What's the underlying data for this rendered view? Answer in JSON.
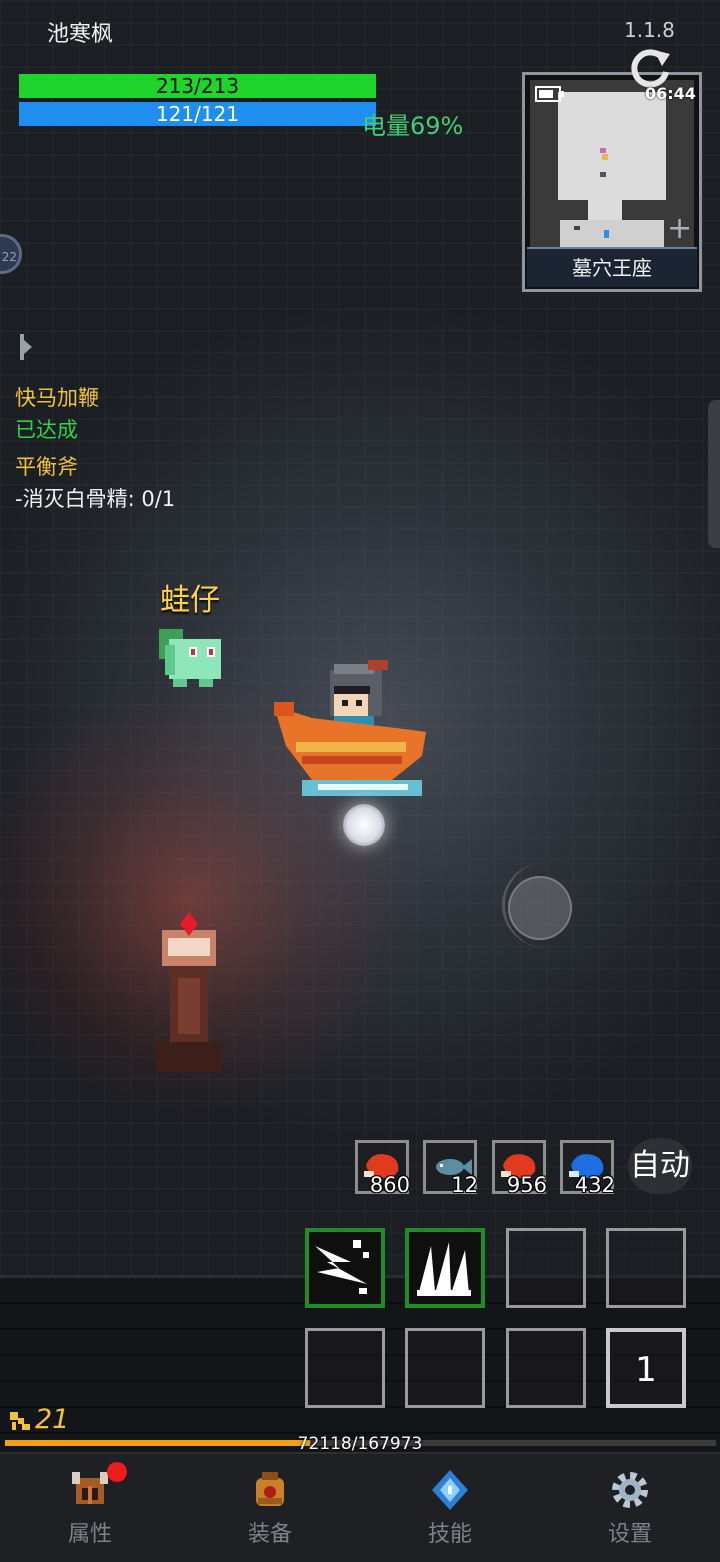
{
  "header": {
    "player_name": "池寒枫",
    "version": "1.1.8",
    "hp_text": "213/213",
    "hp_fraction": 1.0,
    "mp_text": "121/121",
    "mp_fraction": 1.0,
    "battery_text": "电量69%"
  },
  "minimap": {
    "clock": "06:44",
    "location": "墓穴王座",
    "plus": "+"
  },
  "quests": [
    {
      "title": "快马加鞭",
      "detail": "已达成"
    },
    {
      "title": "平衡斧",
      "detail": "-消灭白骨精: 0/1"
    }
  ],
  "pet": {
    "name": "蛙仔"
  },
  "potions": [
    {
      "icon": "red-meat-icon",
      "count": "860"
    },
    {
      "icon": "fish-icon",
      "count": "12"
    },
    {
      "icon": "red-meat-icon",
      "count": "956"
    },
    {
      "icon": "blue-meat-icon",
      "count": "432"
    }
  ],
  "auto_label": "自动",
  "skills": {
    "potion_slot_number": "1"
  },
  "experience": {
    "level": "21",
    "text": "72118/167973",
    "fraction": 0.429
  },
  "nav": [
    {
      "label": "属性",
      "icon": "helmet-icon",
      "has_notification": true
    },
    {
      "label": "装备",
      "icon": "backpack-icon",
      "has_notification": false
    },
    {
      "label": "技能",
      "icon": "crystal-icon",
      "has_notification": false
    },
    {
      "label": "设置",
      "icon": "gear-icon",
      "has_notification": false
    }
  ],
  "colors": {
    "hp": "#1fd42a",
    "mp": "#1f8ef0",
    "xp": "#f0a017",
    "quest_title": "#f2c23a",
    "quest_done": "#2fd24c",
    "battery_text": "#3fcf74",
    "pet_name": "#ffd24a"
  }
}
